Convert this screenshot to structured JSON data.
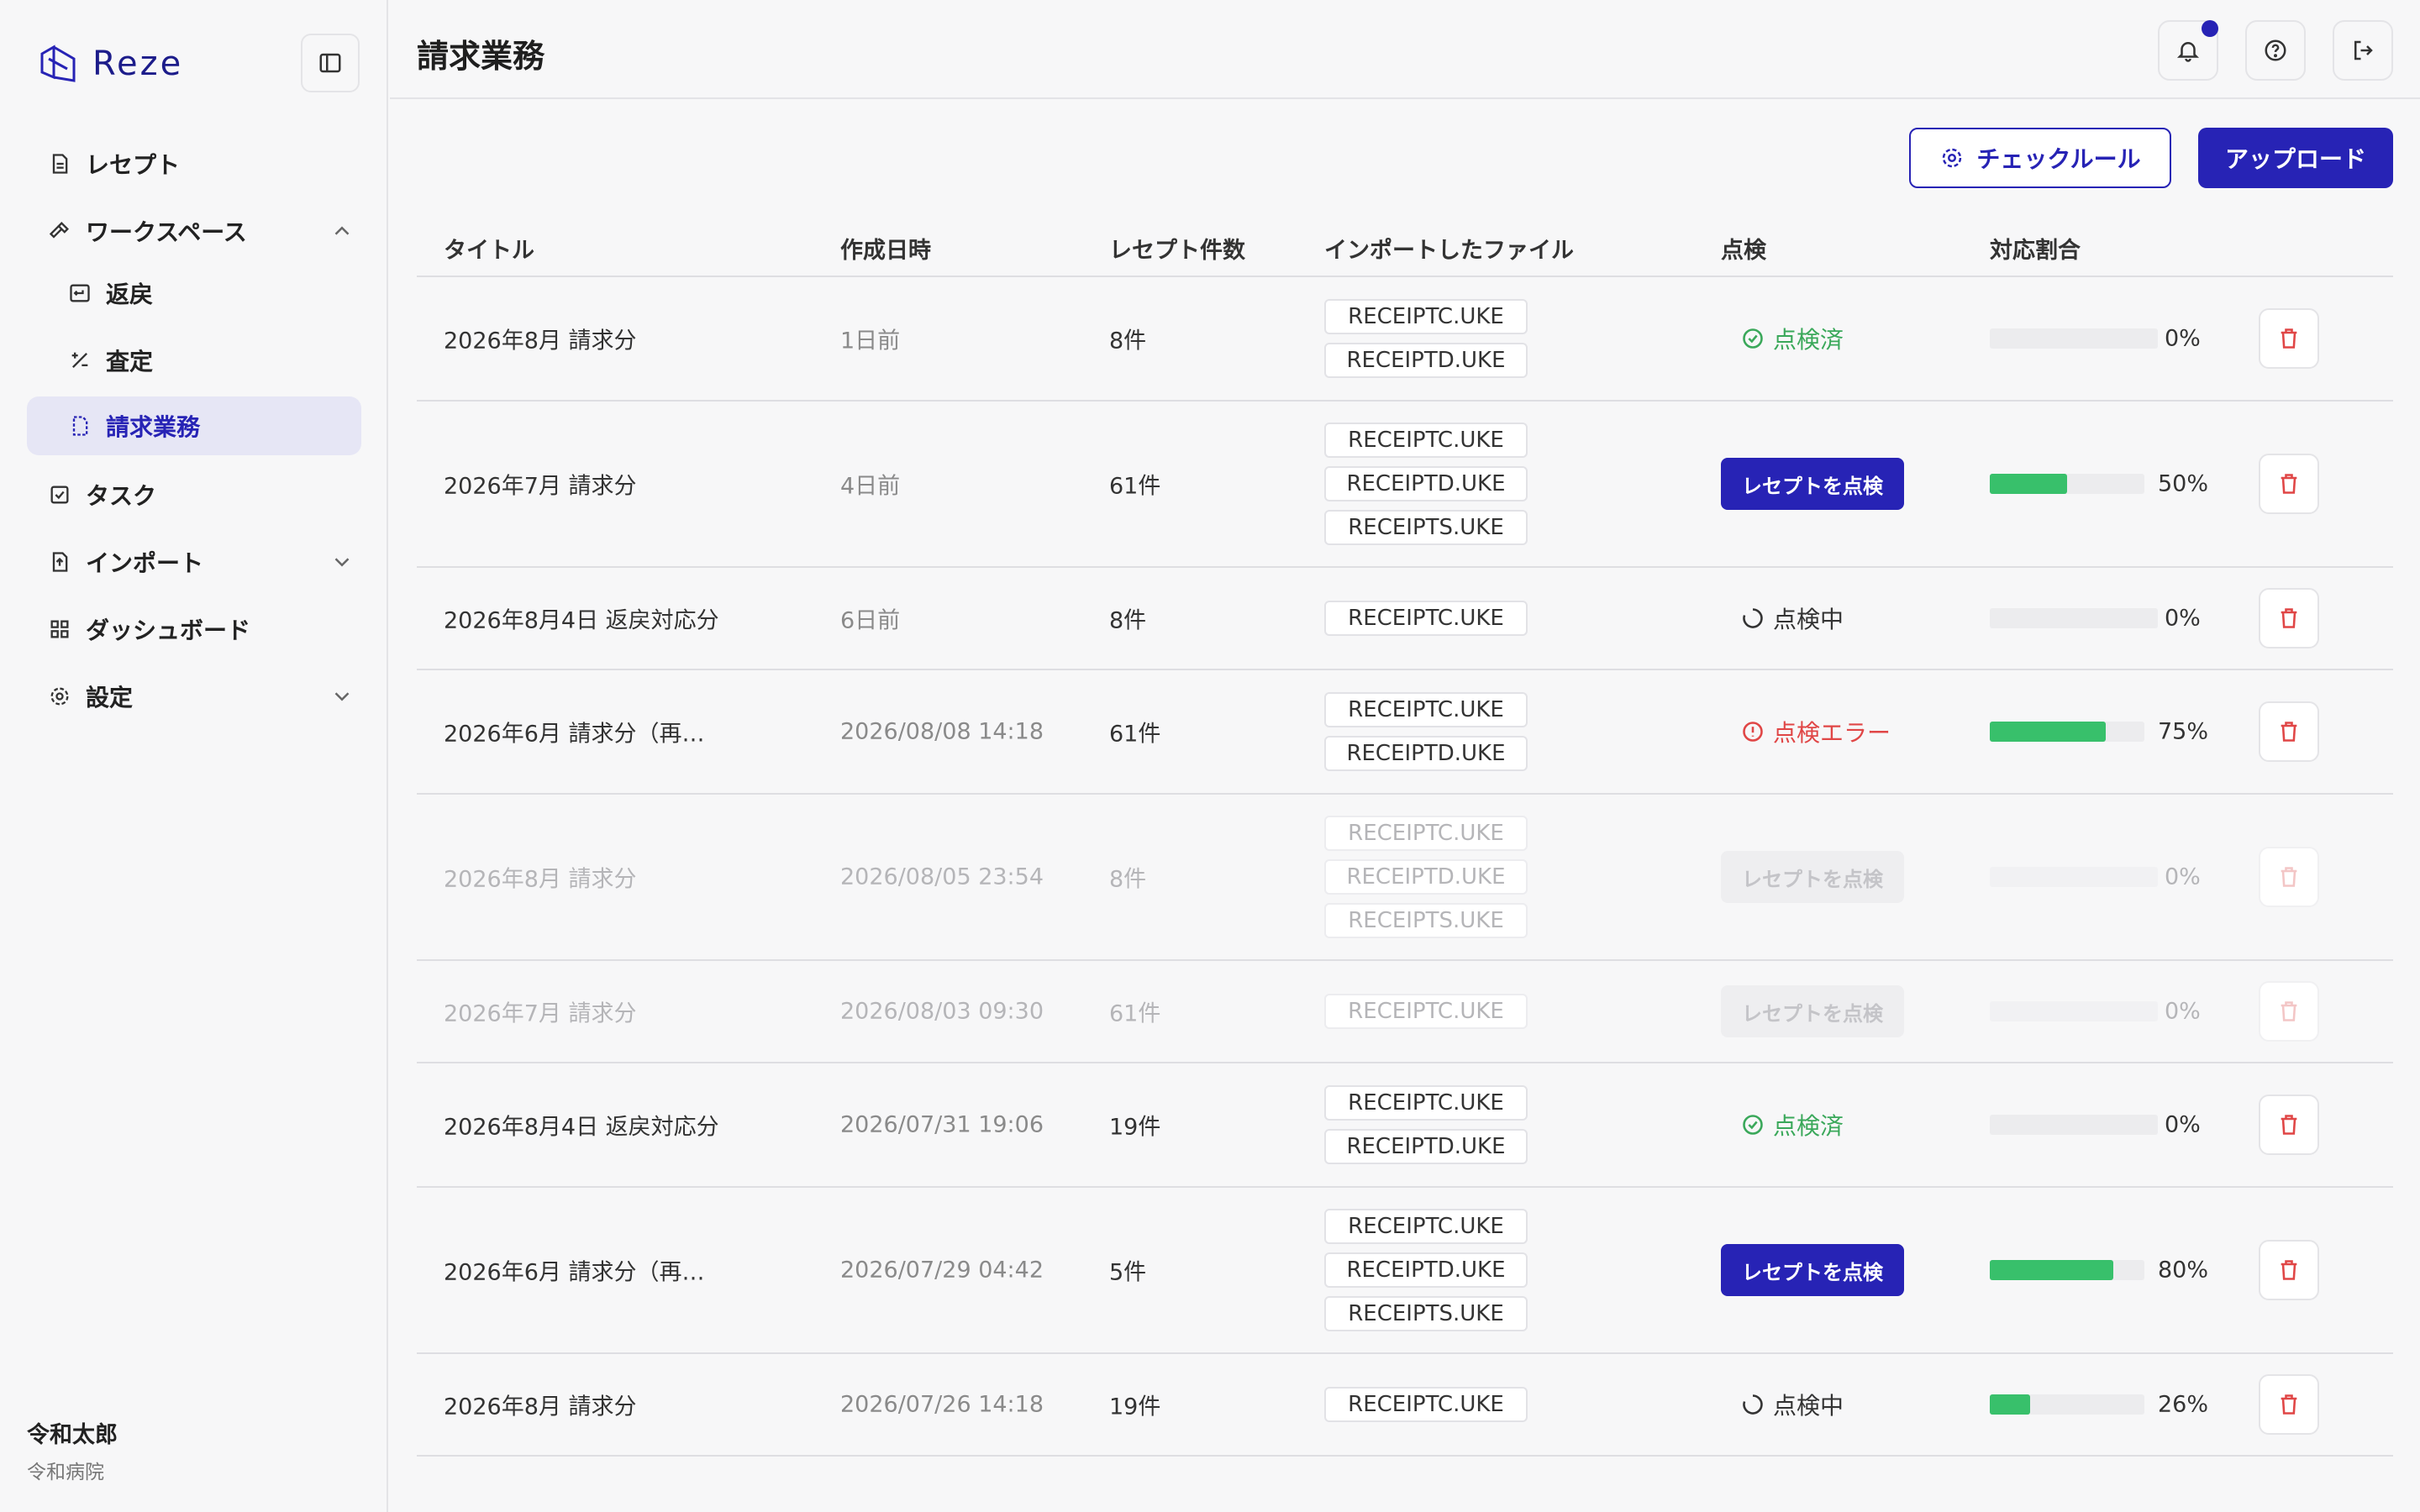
{
  "app": {
    "name": "Reze"
  },
  "nav": {
    "receipt": "レセプト",
    "workspace": "ワークスペース",
    "henrei": "返戻",
    "satei": "査定",
    "billing": "請求業務",
    "task": "タスク",
    "import": "インポート",
    "dashboard": "ダッシュボード",
    "settings": "設定"
  },
  "user": {
    "name": "令和太郎",
    "org": "令和病院"
  },
  "header": {
    "title": "請求業務"
  },
  "actions": {
    "check_rule": "チェックルール",
    "upload": "アップロード"
  },
  "table": {
    "columns": [
      "タイトル",
      "作成日時",
      "レセプト件数",
      "インポートしたファイル",
      "点検",
      "対応割合"
    ],
    "rows": [
      {
        "title": "2026年8月 請求分",
        "date": "1日前",
        "count": "8件",
        "files": [
          "RECEIPTC.UKE",
          "RECEIPTD.UKE"
        ],
        "status_type": "done",
        "status": "点検済",
        "progress": 0,
        "pct": "0%",
        "disabled": false
      },
      {
        "title": "2026年7月 請求分",
        "date": "4日前",
        "count": "61件",
        "files": [
          "RECEIPTC.UKE",
          "RECEIPTD.UKE",
          "RECEIPTS.UKE"
        ],
        "status_type": "button",
        "status": "レセプトを点検",
        "progress": 50,
        "pct": "50%",
        "disabled": false
      },
      {
        "title": "2026年8月4日 返戻対応分",
        "date": "6日前",
        "count": "8件",
        "files": [
          "RECEIPTC.UKE"
        ],
        "status_type": "progress",
        "status": "点検中",
        "progress": 0,
        "pct": "0%",
        "disabled": false
      },
      {
        "title": "2026年6月 請求分（再…",
        "date": "2026/08/08 14:18",
        "count": "61件",
        "files": [
          "RECEIPTC.UKE",
          "RECEIPTD.UKE"
        ],
        "status_type": "error",
        "status": "点検エラー",
        "progress": 75,
        "pct": "75%",
        "disabled": false
      },
      {
        "title": "2026年8月 請求分",
        "date": "2026/08/05 23:54",
        "count": "8件",
        "files": [
          "RECEIPTC.UKE",
          "RECEIPTD.UKE",
          "RECEIPTS.UKE"
        ],
        "status_type": "button",
        "status": "レセプトを点検",
        "progress": 0,
        "pct": "0%",
        "disabled": true
      },
      {
        "title": "2026年7月 請求分",
        "date": "2026/08/03 09:30",
        "count": "61件",
        "files": [
          "RECEIPTC.UKE"
        ],
        "status_type": "button",
        "status": "レセプトを点検",
        "progress": 0,
        "pct": "0%",
        "disabled": true
      },
      {
        "title": "2026年8月4日 返戻対応分",
        "date": "2026/07/31 19:06",
        "count": "19件",
        "files": [
          "RECEIPTC.UKE",
          "RECEIPTD.UKE"
        ],
        "status_type": "done",
        "status": "点検済",
        "progress": 0,
        "pct": "0%",
        "disabled": false
      },
      {
        "title": "2026年6月 請求分（再…",
        "date": "2026/07/29 04:42",
        "count": "5件",
        "files": [
          "RECEIPTC.UKE",
          "RECEIPTD.UKE",
          "RECEIPTS.UKE"
        ],
        "status_type": "button",
        "status": "レセプトを点検",
        "progress": 80,
        "pct": "80%",
        "disabled": false
      },
      {
        "title": "2026年8月 請求分",
        "date": "2026/07/26 14:18",
        "count": "19件",
        "files": [
          "RECEIPTC.UKE"
        ],
        "status_type": "progress",
        "status": "点検中",
        "progress": 26,
        "pct": "26%",
        "disabled": false
      }
    ]
  }
}
